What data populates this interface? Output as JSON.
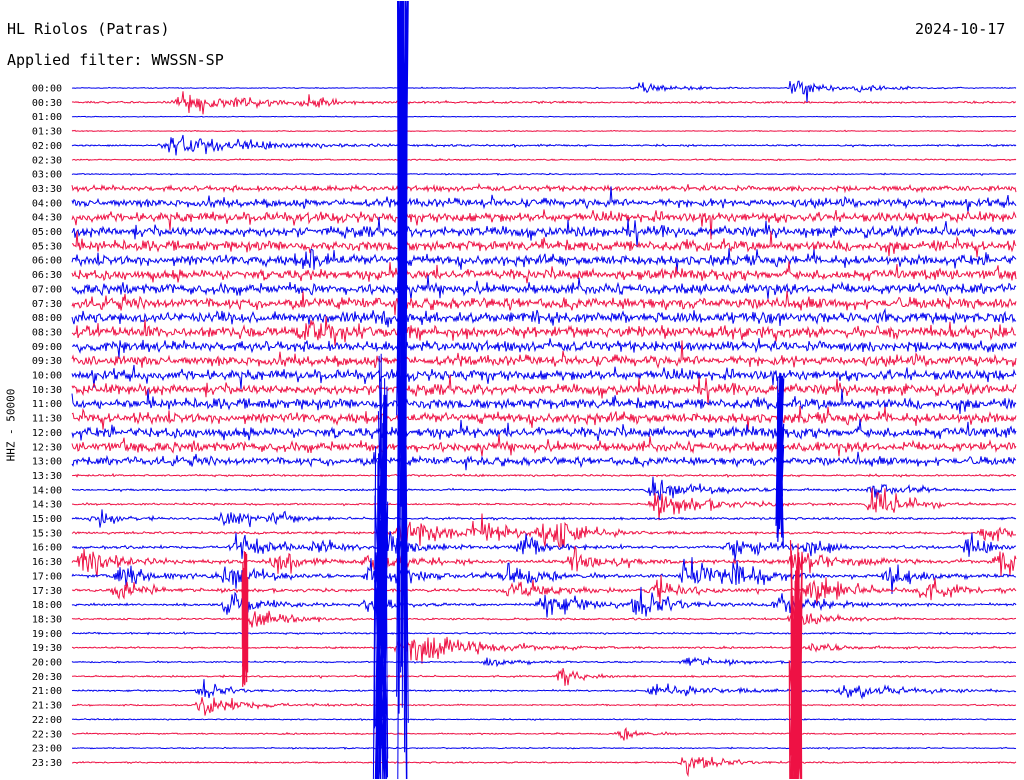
{
  "header": {
    "station": "HL Riolos (Patras)",
    "filter": "Applied filter: WWSSN-SP",
    "date": "2024-10-17"
  },
  "chart_data": {
    "type": "line",
    "title": "HL Riolos (Patras)",
    "subtitle": "Applied filter: WWSSN-SP",
    "date": "2024-10-17",
    "ylabel": "HHZ - 50000",
    "xlabel": "",
    "row_minutes": 30,
    "rows": [
      "00:00",
      "00:30",
      "01:00",
      "01:30",
      "02:00",
      "02:30",
      "03:00",
      "03:30",
      "04:00",
      "04:30",
      "05:00",
      "05:30",
      "06:00",
      "06:30",
      "07:00",
      "07:30",
      "08:00",
      "08:30",
      "09:00",
      "09:30",
      "10:00",
      "10:30",
      "11:00",
      "11:30",
      "12:00",
      "12:30",
      "13:00",
      "13:30",
      "14:00",
      "14:30",
      "15:00",
      "15:30",
      "16:00",
      "16:30",
      "17:00",
      "17:30",
      "18:00",
      "18:30",
      "19:00",
      "19:30",
      "20:00",
      "20:30",
      "21:00",
      "21:30",
      "22:00",
      "22:30",
      "23:00",
      "23:30"
    ],
    "noise_level": [
      0.4,
      0.8,
      0.3,
      0.4,
      0.7,
      0.6,
      0.5,
      2.2,
      3.4,
      4.1,
      4.3,
      4.2,
      4.2,
      4.1,
      4.3,
      4.5,
      4.6,
      4.5,
      4.3,
      4.2,
      4.4,
      4.3,
      4.2,
      4.3,
      4.1,
      4.0,
      3.4,
      0.8,
      0.8,
      0.8,
      0.9,
      1.0,
      1.2,
      1.5,
      1.4,
      1.2,
      1.0,
      0.8,
      0.7,
      0.7,
      0.6,
      0.7,
      0.7,
      0.6,
      0.5,
      0.6,
      0.5,
      0.6
    ],
    "series_colors": [
      "#0000ee",
      "#ee1144"
    ],
    "events": [
      {
        "row": 0,
        "minute": 23.0,
        "amp": 14,
        "dur": 1.0
      },
      {
        "row": 0,
        "minute": 18.0,
        "amp": 4,
        "dur": 2.0
      },
      {
        "row": 0,
        "minute": 25.0,
        "amp": 4,
        "dur": 1.5
      },
      {
        "row": 1,
        "minute": 3.5,
        "amp": 8,
        "dur": 4.0
      },
      {
        "row": 1,
        "minute": 7.5,
        "amp": 5,
        "dur": 1.0
      },
      {
        "row": 4,
        "minute": 3.0,
        "amp": 9,
        "dur": 4.0
      },
      {
        "row": 12,
        "minute": 7.5,
        "amp": 10,
        "dur": 0.8
      },
      {
        "row": 17,
        "minute": 7.5,
        "amp": 8,
        "dur": 2.5
      },
      {
        "row": 28,
        "minute": 18.5,
        "amp": 8,
        "dur": 2.5
      },
      {
        "row": 28,
        "minute": 25.5,
        "amp": 8,
        "dur": 1.5
      },
      {
        "row": 29,
        "minute": 18.5,
        "amp": 10,
        "dur": 2.5
      },
      {
        "row": 29,
        "minute": 25.5,
        "amp": 16,
        "dur": 1.5
      },
      {
        "row": 30,
        "minute": 0.8,
        "amp": 8,
        "dur": 1.0
      },
      {
        "row": 30,
        "minute": 4.8,
        "amp": 9,
        "dur": 1.2
      },
      {
        "row": 30,
        "minute": 6.4,
        "amp": 7,
        "dur": 0.8
      },
      {
        "row": 31,
        "minute": 10.5,
        "amp": 13,
        "dur": 2.5
      },
      {
        "row": 31,
        "minute": 12.8,
        "amp": 11,
        "dur": 1.5
      },
      {
        "row": 31,
        "minute": 15.5,
        "amp": 10,
        "dur": 1.5
      },
      {
        "row": 31,
        "minute": 15.0,
        "amp": 10,
        "dur": 1.0
      },
      {
        "row": 31,
        "minute": 29.0,
        "amp": 9,
        "dur": 1.0
      },
      {
        "row": 32,
        "minute": 5.2,
        "amp": 11,
        "dur": 1.5
      },
      {
        "row": 32,
        "minute": 7.8,
        "amp": 8,
        "dur": 1.0
      },
      {
        "row": 32,
        "minute": 10.0,
        "amp": 12,
        "dur": 1.8
      },
      {
        "row": 32,
        "minute": 14.3,
        "amp": 10,
        "dur": 1.2
      },
      {
        "row": 32,
        "minute": 21.0,
        "amp": 10,
        "dur": 1.5
      },
      {
        "row": 32,
        "minute": 23.5,
        "amp": 9,
        "dur": 1.0
      },
      {
        "row": 32,
        "minute": 28.5,
        "amp": 9,
        "dur": 1.0
      },
      {
        "row": 33,
        "minute": 0.4,
        "amp": 14,
        "dur": 1.5
      },
      {
        "row": 33,
        "minute": 6.5,
        "amp": 10,
        "dur": 1.0
      },
      {
        "row": 33,
        "minute": 9.5,
        "amp": 12,
        "dur": 1.5
      },
      {
        "row": 33,
        "minute": 16.0,
        "amp": 12,
        "dur": 1.5
      },
      {
        "row": 33,
        "minute": 23.0,
        "amp": 12,
        "dur": 2.0
      },
      {
        "row": 33,
        "minute": 29.5,
        "amp": 14,
        "dur": 1.0
      },
      {
        "row": 34,
        "minute": 1.5,
        "amp": 12,
        "dur": 1.5
      },
      {
        "row": 34,
        "minute": 5.0,
        "amp": 10,
        "dur": 1.5
      },
      {
        "row": 34,
        "minute": 9.5,
        "amp": 12,
        "dur": 2.0
      },
      {
        "row": 34,
        "minute": 13.8,
        "amp": 12,
        "dur": 1.5
      },
      {
        "row": 34,
        "minute": 19.5,
        "amp": 14,
        "dur": 1.5
      },
      {
        "row": 34,
        "minute": 21.0,
        "amp": 12,
        "dur": 1.5
      },
      {
        "row": 34,
        "minute": 26.0,
        "amp": 12,
        "dur": 1.5
      },
      {
        "row": 35,
        "minute": 1.5,
        "amp": 8,
        "dur": 1.5
      },
      {
        "row": 35,
        "minute": 14.0,
        "amp": 12,
        "dur": 1.8
      },
      {
        "row": 35,
        "minute": 18.5,
        "amp": 10,
        "dur": 1.5
      },
      {
        "row": 35,
        "minute": 23.5,
        "amp": 12,
        "dur": 2.0
      },
      {
        "row": 35,
        "minute": 27.0,
        "amp": 10,
        "dur": 1.5
      },
      {
        "row": 36,
        "minute": 5.0,
        "amp": 12,
        "dur": 1.5
      },
      {
        "row": 36,
        "minute": 9.5,
        "amp": 9,
        "dur": 1.0
      },
      {
        "row": 36,
        "minute": 15.0,
        "amp": 12,
        "dur": 2.0
      },
      {
        "row": 36,
        "minute": 18.0,
        "amp": 14,
        "dur": 1.5
      },
      {
        "row": 36,
        "minute": 22.5,
        "amp": 10,
        "dur": 2.0
      },
      {
        "row": 37,
        "minute": 5.8,
        "amp": 10,
        "dur": 1.5
      },
      {
        "row": 37,
        "minute": 23.0,
        "amp": 9,
        "dur": 1.5
      },
      {
        "row": 39,
        "minute": 10.5,
        "amp": 18,
        "dur": 3.0
      },
      {
        "row": 39,
        "minute": 23.5,
        "amp": 4,
        "dur": 2.0
      },
      {
        "row": 40,
        "minute": 13.2,
        "amp": 5,
        "dur": 1.5
      },
      {
        "row": 40,
        "minute": 19.5,
        "amp": 6,
        "dur": 1.5
      },
      {
        "row": 41,
        "minute": 15.5,
        "amp": 8,
        "dur": 1.0
      },
      {
        "row": 42,
        "minute": 4.2,
        "amp": 9,
        "dur": 1.0
      },
      {
        "row": 42,
        "minute": 18.5,
        "amp": 6,
        "dur": 3.0
      },
      {
        "row": 42,
        "minute": 24.5,
        "amp": 7,
        "dur": 3.0
      },
      {
        "row": 43,
        "minute": 4.2,
        "amp": 9,
        "dur": 2.0
      },
      {
        "row": 45,
        "minute": 17.5,
        "amp": 5,
        "dur": 1.0
      },
      {
        "row": 47,
        "minute": 19.5,
        "amp": 10,
        "dur": 1.5
      }
    ],
    "spikes": [
      {
        "row": 0,
        "minute": 10.5,
        "amp": 780,
        "width": 0.3
      },
      {
        "row": 38,
        "minute": 9.8,
        "amp": 300,
        "width": 0.35
      },
      {
        "row": 43,
        "minute": 23.0,
        "amp": 180,
        "width": 0.3
      },
      {
        "row": 26,
        "minute": 22.5,
        "amp": 90,
        "width": 0.2
      },
      {
        "row": 37,
        "minute": 5.5,
        "amp": 70,
        "width": 0.15
      }
    ]
  }
}
